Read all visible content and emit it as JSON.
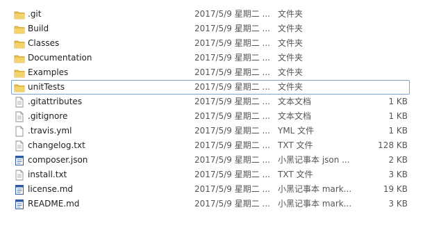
{
  "colors": {
    "folder": "#e8c04d",
    "folder_dark": "#c99a22",
    "focus_border": "#7da2ce",
    "doc_border": "#8a8a8a",
    "notepad_blue": "#2a5aa8"
  },
  "files": [
    {
      "name": ".git",
      "date": "2017/5/9 星期二 ...",
      "type": "文件夹",
      "size": "",
      "icon": "folder-icon"
    },
    {
      "name": "Build",
      "date": "2017/5/9 星期二 ...",
      "type": "文件夹",
      "size": "",
      "icon": "folder-icon"
    },
    {
      "name": "Classes",
      "date": "2017/5/9 星期二 ...",
      "type": "文件夹",
      "size": "",
      "icon": "folder-icon"
    },
    {
      "name": "Documentation",
      "date": "2017/5/9 星期二 ...",
      "type": "文件夹",
      "size": "",
      "icon": "folder-icon"
    },
    {
      "name": "Examples",
      "date": "2017/5/9 星期二 ...",
      "type": "文件夹",
      "size": "",
      "icon": "folder-icon"
    },
    {
      "name": "unitTests",
      "date": "2017/5/9 星期二 ...",
      "type": "文件夹",
      "size": "",
      "icon": "folder-icon"
    },
    {
      "name": ".gitattributes",
      "date": "2017/5/9 星期二 ...",
      "type": "文本文档",
      "size": "1 KB",
      "icon": "text-document-icon"
    },
    {
      "name": ".gitignore",
      "date": "2017/5/9 星期二 ...",
      "type": "文本文档",
      "size": "1 KB",
      "icon": "text-document-icon"
    },
    {
      "name": ".travis.yml",
      "date": "2017/5/9 星期二 ...",
      "type": "YML 文件",
      "size": "1 KB",
      "icon": "blank-file-icon"
    },
    {
      "name": "changelog.txt",
      "date": "2017/5/9 星期二 ...",
      "type": "TXT 文件",
      "size": "128 KB",
      "icon": "text-document-icon"
    },
    {
      "name": "composer.json",
      "date": "2017/5/9 星期二 ...",
      "type": "小黑记事本 json ...",
      "size": "2 KB",
      "icon": "notepad-icon"
    },
    {
      "name": "install.txt",
      "date": "2017/5/9 星期二 ...",
      "type": "TXT 文件",
      "size": "3 KB",
      "icon": "text-document-icon"
    },
    {
      "name": "license.md",
      "date": "2017/5/9 星期二 ...",
      "type": "小黑记事本 mark...",
      "size": "19 KB",
      "icon": "notepad-icon"
    },
    {
      "name": "README.md",
      "date": "2017/5/9 星期二 ...",
      "type": "小黑记事本 mark...",
      "size": "3 KB",
      "icon": "notepad-icon"
    }
  ]
}
